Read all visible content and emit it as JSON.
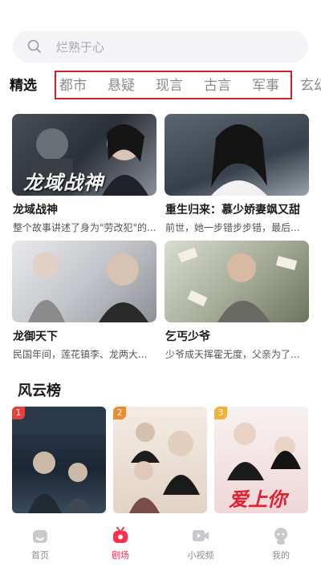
{
  "search": {
    "placeholder": "烂熟于心"
  },
  "tabs": {
    "selected": "精选",
    "items": [
      "都市",
      "悬疑",
      "现言",
      "古言",
      "军事",
      "玄幻"
    ]
  },
  "cards": [
    {
      "title": "龙域战神",
      "desc": "整个故事讲述了身为\"劳改犯\"的...",
      "overlay": "龙域战神"
    },
    {
      "title": "重生归来：慕少娇妻飒又甜",
      "desc": "前世，她一步错步步错，最后..."
    },
    {
      "title": "龙御天下",
      "desc": "民国年间，莲花镇李、龙两大..."
    },
    {
      "title": "乞丐少爷",
      "desc": "少爷成天挥霍无度，父亲为了..."
    }
  ],
  "section": {
    "title": "风云榜"
  },
  "rank": [
    {
      "no": "1",
      "color": "#e8403b"
    },
    {
      "no": "2",
      "color": "#f08a2e"
    },
    {
      "no": "3",
      "color": "#f2b236",
      "overlay": "爱上你"
    }
  ],
  "tabbar": [
    {
      "label": "首页",
      "icon": "home-icon"
    },
    {
      "label": "剧场",
      "icon": "theater-icon"
    },
    {
      "label": "小视频",
      "icon": "video-icon"
    },
    {
      "label": "我的",
      "icon": "profile-icon"
    }
  ],
  "colors": {
    "accent": "#ff2e4d",
    "highlight_box": "#d4202a"
  }
}
